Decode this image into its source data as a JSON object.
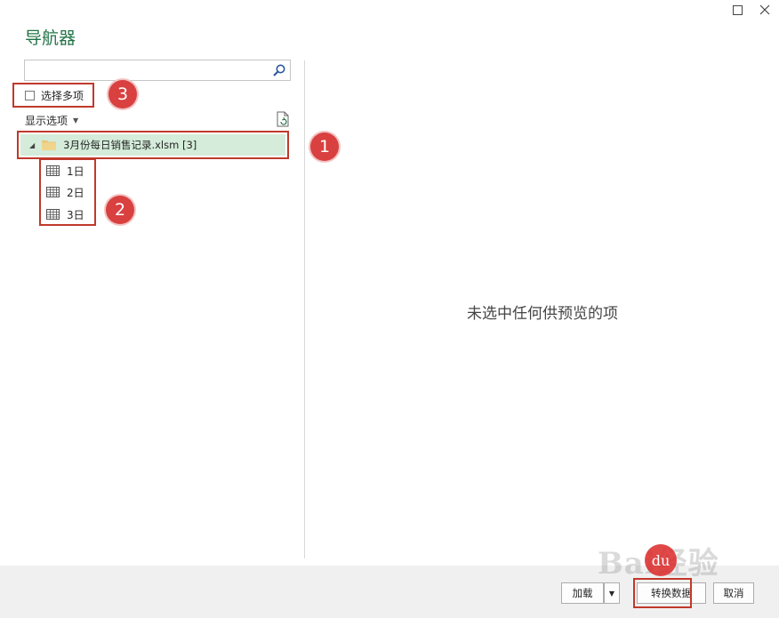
{
  "window": {
    "title": "导航器",
    "maximize_icon": "maximize-icon",
    "close_icon": "close-icon"
  },
  "search": {
    "value": "",
    "placeholder": ""
  },
  "options": {
    "select_multiple_label": "选择多项",
    "select_multiple_checked": false,
    "display_options_label": "显示选项"
  },
  "tree": {
    "file": {
      "name": "3月份每日销售记录.xlsm [3]",
      "expanded": true
    },
    "sheets": [
      {
        "label": "1日"
      },
      {
        "label": "2日"
      },
      {
        "label": "3日"
      }
    ]
  },
  "preview": {
    "message": "未选中任何供预览的项"
  },
  "callouts": [
    "1",
    "2",
    "3"
  ],
  "footer": {
    "load_label": "加载",
    "transform_label": "转换数据",
    "cancel_label": "取消"
  },
  "watermark": {
    "text": "Bai经验",
    "badge": "du"
  },
  "colors": {
    "title": "#217346",
    "selected_row": "#d4ecd9",
    "highlight_box": "#c0392b",
    "callout": "#d94040"
  }
}
